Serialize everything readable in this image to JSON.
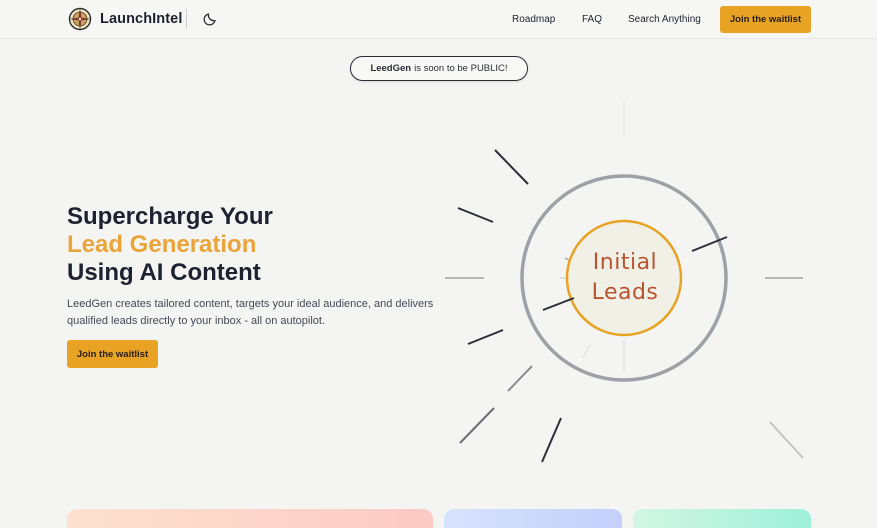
{
  "header": {
    "brand": "LaunchIntel",
    "nav": {
      "roadmap": "Roadmap",
      "faq": "FAQ",
      "search": "Search Anything"
    },
    "cta": "Join the waitlist"
  },
  "announcement": {
    "product": "LeedGen",
    "text": "is soon to be PUBLIC!"
  },
  "hero": {
    "title_line1": "Supercharge Your",
    "title_line2": "Lead Generation",
    "title_line3": "Using AI Content",
    "subtitle": "LeedGen creates tailored content, targets your ideal audience, and delivers qualified leads directly to your inbox - all on autopilot.",
    "cta": "Join the waitlist"
  },
  "illustration": {
    "center_line1": "Initial",
    "center_line2": "Leads"
  },
  "colors": {
    "accent": "#e8a325",
    "accent_text": "#eba43a",
    "center_label": "#b8552f",
    "ring": "#9ea2a6"
  }
}
